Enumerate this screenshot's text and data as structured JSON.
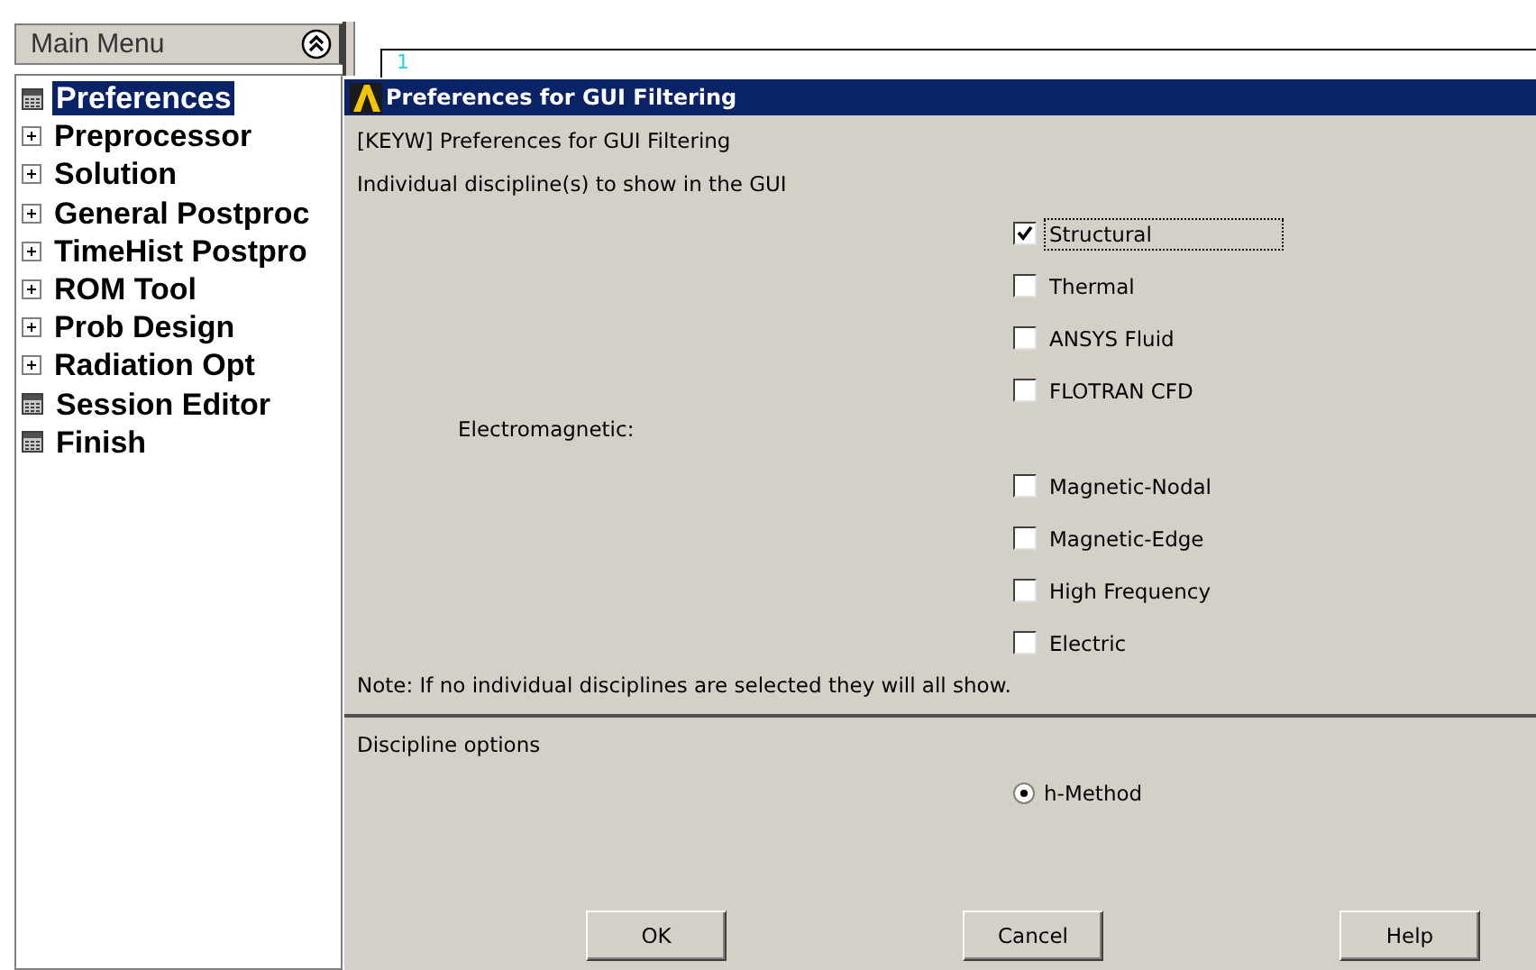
{
  "main_menu": {
    "title": "Main Menu",
    "items": [
      {
        "label": "Preferences",
        "kind": "page",
        "selected": true
      },
      {
        "label": "Preprocessor",
        "kind": "folder",
        "selected": false
      },
      {
        "label": "Solution",
        "kind": "folder",
        "selected": false
      },
      {
        "label": "General Postproc",
        "kind": "folder",
        "selected": false
      },
      {
        "label": "TimeHist Postpro",
        "kind": "folder",
        "selected": false
      },
      {
        "label": "ROM Tool",
        "kind": "folder",
        "selected": false
      },
      {
        "label": "Prob Design",
        "kind": "folder",
        "selected": false
      },
      {
        "label": "Radiation Opt",
        "kind": "folder",
        "selected": false
      },
      {
        "label": "Session Editor",
        "kind": "page",
        "selected": false
      },
      {
        "label": "Finish",
        "kind": "page",
        "selected": false
      }
    ]
  },
  "graphics_window": {
    "window_number": "1"
  },
  "dialog": {
    "title": "Preferences for GUI Filtering",
    "keyword_line": "[KEYW] Preferences for GUI Filtering",
    "prompt": "Individual discipline(s) to show in the GUI",
    "options": [
      {
        "kind": "checkbox",
        "label": "Structural",
        "checked": true,
        "focused": true
      },
      {
        "kind": "checkbox",
        "label": "Thermal",
        "checked": false,
        "focused": false
      },
      {
        "kind": "checkbox",
        "label": "ANSYS Fluid",
        "checked": false,
        "focused": false
      },
      {
        "kind": "checkbox",
        "label": "FLOTRAN CFD",
        "checked": false,
        "focused": false
      },
      {
        "kind": "heading",
        "label": "Electromagnetic:"
      },
      {
        "kind": "checkbox",
        "label": "Magnetic-Nodal",
        "checked": false,
        "focused": false
      },
      {
        "kind": "checkbox",
        "label": "Magnetic-Edge",
        "checked": false,
        "focused": false
      },
      {
        "kind": "checkbox",
        "label": "High Frequency",
        "checked": false,
        "focused": false
      },
      {
        "kind": "checkbox",
        "label": "Electric",
        "checked": false,
        "focused": false
      }
    ],
    "note": "Note: If no individual disciplines are selected they will all show.",
    "section_title": "Discipline options",
    "radios": [
      {
        "label": "h-Method",
        "selected": true
      }
    ],
    "buttons": [
      "OK",
      "Cancel",
      "Help"
    ]
  }
}
